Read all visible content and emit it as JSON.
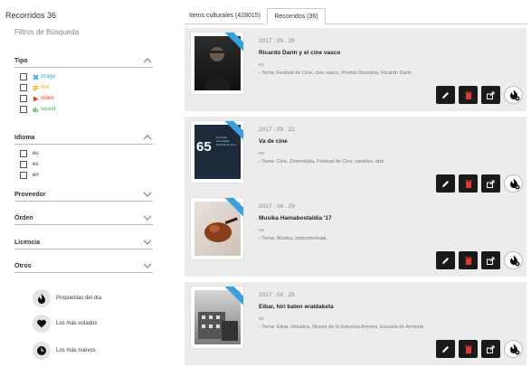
{
  "sidebar": {
    "title": "Recorridos 36",
    "subtitle": "Filtros de Búsqueda",
    "tipo": {
      "label": "Tipo",
      "options": [
        {
          "label": "image",
          "color": "#2ea8e0",
          "icon": "image-icon"
        },
        {
          "label": "text",
          "color": "#f0b400",
          "icon": "text-icon"
        },
        {
          "label": "video",
          "color": "#e8401c",
          "icon": "video-icon"
        },
        {
          "label": "sound",
          "color": "#3db54a",
          "icon": "sound-icon"
        }
      ]
    },
    "idioma": {
      "label": "Idioma",
      "options": [
        {
          "label": "eu"
        },
        {
          "label": "es"
        },
        {
          "label": "en"
        }
      ]
    },
    "proveedor": {
      "label": "Proveedor"
    },
    "orden": {
      "label": "Órden"
    },
    "licencia": {
      "label": "Licencia"
    },
    "otros": {
      "label": "Otros"
    },
    "quick": [
      {
        "label": "Propuestas del día",
        "icon": "flame-icon"
      },
      {
        "label": "Los más votados",
        "icon": "heart-icon"
      },
      {
        "label": "Los más nuevos",
        "icon": "clock-icon"
      }
    ]
  },
  "tabs": [
    {
      "label": "Items culturales (428015)",
      "active": false
    },
    {
      "label": "Recorridos (36)",
      "active": true
    }
  ],
  "cards": [
    {
      "date": "2017 . 09 . 28",
      "title": "Ricardo Darín y el cine vasco",
      "lang": "es",
      "tema": "Tema: Festival de Cine, cine vasco, Premio Donostia, Ricardo Darín"
    },
    {
      "date": "2017 . 09 . 22",
      "title": "Va de cine",
      "lang": "es",
      "tema": "Tema: Cine, Zinemaldia, Festival de Cine, carteles, arte",
      "poster_number": "65",
      "poster_text": "Donostia Zinemaldia Festival de Cine"
    },
    {
      "date": "2017 . 08 . 29",
      "title": "Musika Hamabostaldia '17",
      "lang": "eu",
      "tema": "Tema: Musika, instrumentuak"
    },
    {
      "date": "2017 . 08 . 25",
      "title": "Eibar, hiri baten eraldaketa",
      "lang": "es",
      "tema": "Tema: Eibar, industria, Museo de la Industria Armera, Escuela de Armería"
    }
  ],
  "colors": {
    "accent": "#3aa0dd",
    "card_bg": "#ececec",
    "button_bg": "#1a1a1a",
    "delete_red": "#e03a2f",
    "tema_arrow": "#d9534f"
  }
}
